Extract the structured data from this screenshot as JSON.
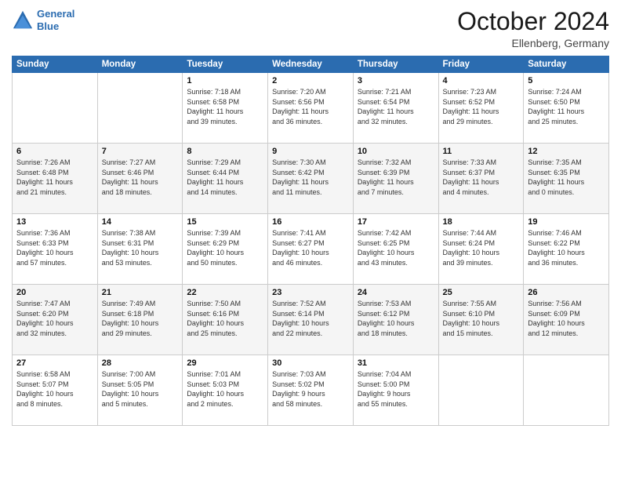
{
  "header": {
    "logo_line1": "General",
    "logo_line2": "Blue",
    "month": "October 2024",
    "location": "Ellenberg, Germany"
  },
  "weekdays": [
    "Sunday",
    "Monday",
    "Tuesday",
    "Wednesday",
    "Thursday",
    "Friday",
    "Saturday"
  ],
  "weeks": [
    [
      {
        "day": "",
        "detail": ""
      },
      {
        "day": "",
        "detail": ""
      },
      {
        "day": "1",
        "detail": "Sunrise: 7:18 AM\nSunset: 6:58 PM\nDaylight: 11 hours\nand 39 minutes."
      },
      {
        "day": "2",
        "detail": "Sunrise: 7:20 AM\nSunset: 6:56 PM\nDaylight: 11 hours\nand 36 minutes."
      },
      {
        "day": "3",
        "detail": "Sunrise: 7:21 AM\nSunset: 6:54 PM\nDaylight: 11 hours\nand 32 minutes."
      },
      {
        "day": "4",
        "detail": "Sunrise: 7:23 AM\nSunset: 6:52 PM\nDaylight: 11 hours\nand 29 minutes."
      },
      {
        "day": "5",
        "detail": "Sunrise: 7:24 AM\nSunset: 6:50 PM\nDaylight: 11 hours\nand 25 minutes."
      }
    ],
    [
      {
        "day": "6",
        "detail": "Sunrise: 7:26 AM\nSunset: 6:48 PM\nDaylight: 11 hours\nand 21 minutes."
      },
      {
        "day": "7",
        "detail": "Sunrise: 7:27 AM\nSunset: 6:46 PM\nDaylight: 11 hours\nand 18 minutes."
      },
      {
        "day": "8",
        "detail": "Sunrise: 7:29 AM\nSunset: 6:44 PM\nDaylight: 11 hours\nand 14 minutes."
      },
      {
        "day": "9",
        "detail": "Sunrise: 7:30 AM\nSunset: 6:42 PM\nDaylight: 11 hours\nand 11 minutes."
      },
      {
        "day": "10",
        "detail": "Sunrise: 7:32 AM\nSunset: 6:39 PM\nDaylight: 11 hours\nand 7 minutes."
      },
      {
        "day": "11",
        "detail": "Sunrise: 7:33 AM\nSunset: 6:37 PM\nDaylight: 11 hours\nand 4 minutes."
      },
      {
        "day": "12",
        "detail": "Sunrise: 7:35 AM\nSunset: 6:35 PM\nDaylight: 11 hours\nand 0 minutes."
      }
    ],
    [
      {
        "day": "13",
        "detail": "Sunrise: 7:36 AM\nSunset: 6:33 PM\nDaylight: 10 hours\nand 57 minutes."
      },
      {
        "day": "14",
        "detail": "Sunrise: 7:38 AM\nSunset: 6:31 PM\nDaylight: 10 hours\nand 53 minutes."
      },
      {
        "day": "15",
        "detail": "Sunrise: 7:39 AM\nSunset: 6:29 PM\nDaylight: 10 hours\nand 50 minutes."
      },
      {
        "day": "16",
        "detail": "Sunrise: 7:41 AM\nSunset: 6:27 PM\nDaylight: 10 hours\nand 46 minutes."
      },
      {
        "day": "17",
        "detail": "Sunrise: 7:42 AM\nSunset: 6:25 PM\nDaylight: 10 hours\nand 43 minutes."
      },
      {
        "day": "18",
        "detail": "Sunrise: 7:44 AM\nSunset: 6:24 PM\nDaylight: 10 hours\nand 39 minutes."
      },
      {
        "day": "19",
        "detail": "Sunrise: 7:46 AM\nSunset: 6:22 PM\nDaylight: 10 hours\nand 36 minutes."
      }
    ],
    [
      {
        "day": "20",
        "detail": "Sunrise: 7:47 AM\nSunset: 6:20 PM\nDaylight: 10 hours\nand 32 minutes."
      },
      {
        "day": "21",
        "detail": "Sunrise: 7:49 AM\nSunset: 6:18 PM\nDaylight: 10 hours\nand 29 minutes."
      },
      {
        "day": "22",
        "detail": "Sunrise: 7:50 AM\nSunset: 6:16 PM\nDaylight: 10 hours\nand 25 minutes."
      },
      {
        "day": "23",
        "detail": "Sunrise: 7:52 AM\nSunset: 6:14 PM\nDaylight: 10 hours\nand 22 minutes."
      },
      {
        "day": "24",
        "detail": "Sunrise: 7:53 AM\nSunset: 6:12 PM\nDaylight: 10 hours\nand 18 minutes."
      },
      {
        "day": "25",
        "detail": "Sunrise: 7:55 AM\nSunset: 6:10 PM\nDaylight: 10 hours\nand 15 minutes."
      },
      {
        "day": "26",
        "detail": "Sunrise: 7:56 AM\nSunset: 6:09 PM\nDaylight: 10 hours\nand 12 minutes."
      }
    ],
    [
      {
        "day": "27",
        "detail": "Sunrise: 6:58 AM\nSunset: 5:07 PM\nDaylight: 10 hours\nand 8 minutes."
      },
      {
        "day": "28",
        "detail": "Sunrise: 7:00 AM\nSunset: 5:05 PM\nDaylight: 10 hours\nand 5 minutes."
      },
      {
        "day": "29",
        "detail": "Sunrise: 7:01 AM\nSunset: 5:03 PM\nDaylight: 10 hours\nand 2 minutes."
      },
      {
        "day": "30",
        "detail": "Sunrise: 7:03 AM\nSunset: 5:02 PM\nDaylight: 9 hours\nand 58 minutes."
      },
      {
        "day": "31",
        "detail": "Sunrise: 7:04 AM\nSunset: 5:00 PM\nDaylight: 9 hours\nand 55 minutes."
      },
      {
        "day": "",
        "detail": ""
      },
      {
        "day": "",
        "detail": ""
      }
    ]
  ]
}
